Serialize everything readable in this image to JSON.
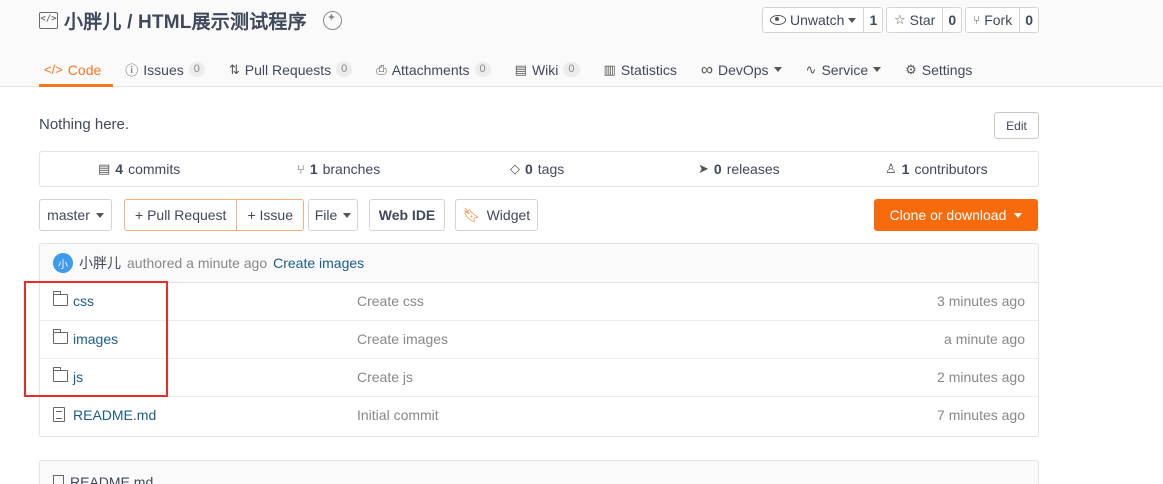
{
  "repo": {
    "title": "小胖儿 / HTML展示测试程序"
  },
  "actions": {
    "watch": {
      "label": "Unwatch",
      "count": "1"
    },
    "star": {
      "label": "Star",
      "count": "0"
    },
    "fork": {
      "label": "Fork",
      "count": "0"
    }
  },
  "tabs": [
    {
      "label": "Code",
      "icon": "</>",
      "badge": ""
    },
    {
      "label": "Issues",
      "icon": "ⓘ",
      "badge": "0"
    },
    {
      "label": "Pull Requests",
      "icon": "⇅",
      "badge": "0"
    },
    {
      "label": "Attachments",
      "icon": "⎙",
      "badge": "0"
    },
    {
      "label": "Wiki",
      "icon": "▤",
      "badge": "0"
    },
    {
      "label": "Statistics",
      "icon": "▥",
      "badge": ""
    },
    {
      "label": "DevOps",
      "icon": "∞",
      "badge": ""
    },
    {
      "label": "Service",
      "icon": "∿",
      "badge": ""
    },
    {
      "label": "Settings",
      "icon": "⚙",
      "badge": ""
    }
  ],
  "description": "Nothing here.",
  "edit_label": "Edit",
  "stats": {
    "commits": {
      "count": "4",
      "label": "commits"
    },
    "branches": {
      "count": "1",
      "label": "branches"
    },
    "tags": {
      "count": "0",
      "label": "tags"
    },
    "releases": {
      "count": "0",
      "label": "releases"
    },
    "contributors": {
      "count": "1",
      "label": "contributors"
    }
  },
  "toolbar": {
    "branch": "master",
    "pull_request": "+ Pull Request",
    "issue": "+ Issue",
    "file": "File",
    "web_ide": "Web IDE",
    "widget": "Widget",
    "clone": "Clone or download"
  },
  "latest_commit": {
    "avatar_text": "小",
    "author": "小胖儿",
    "verb": "authored a minute ago",
    "message": "Create images"
  },
  "files": [
    {
      "name": "css",
      "type": "folder",
      "message": "Create css",
      "time": "3 minutes ago"
    },
    {
      "name": "images",
      "type": "folder",
      "message": "Create images",
      "time": "a minute ago"
    },
    {
      "name": "js",
      "type": "folder",
      "message": "Create js",
      "time": "2 minutes ago"
    },
    {
      "name": "README.md",
      "type": "file",
      "message": "Initial commit",
      "time": "7 minutes ago"
    }
  ],
  "readme": {
    "title": "README.md"
  },
  "colors": {
    "accent": "#f4761f",
    "clone_button": "#f76b0c",
    "highlight_box": "#e82b2b",
    "link": "#1a5c8c"
  }
}
